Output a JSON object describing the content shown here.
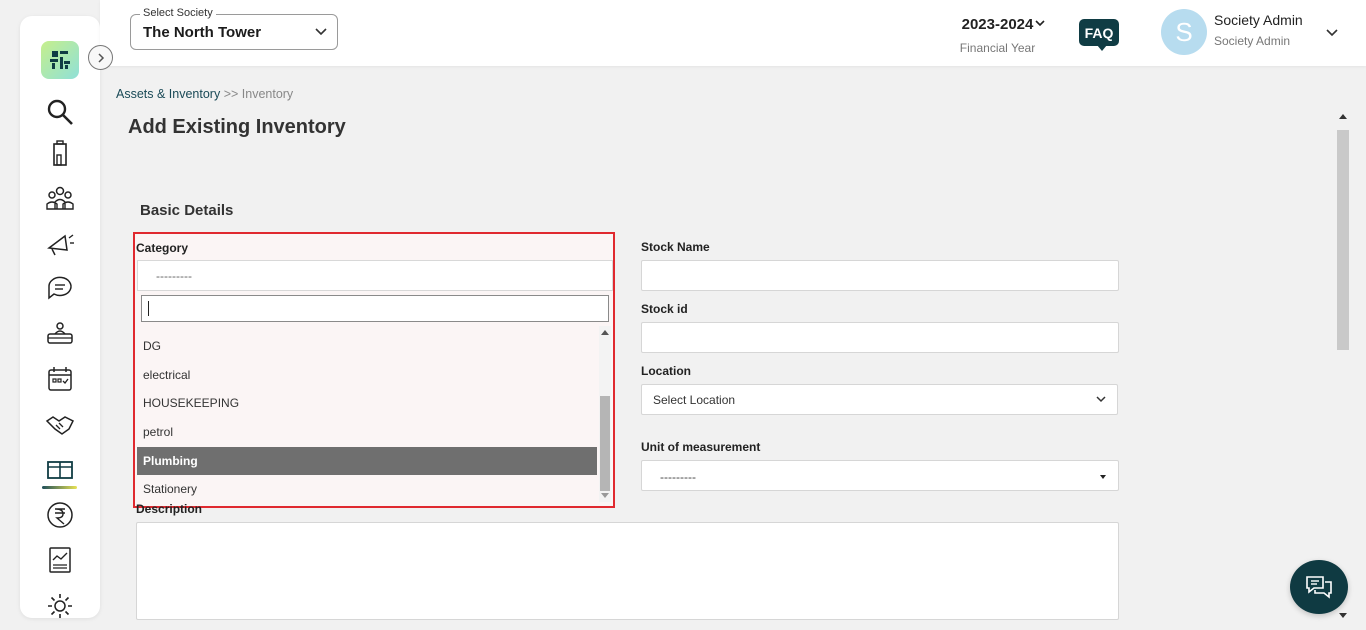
{
  "header": {
    "society_label": "Select Society",
    "society_value": "The North Tower",
    "year": "2023-2024",
    "year_sub": "Financial Year",
    "faq": "FAQ",
    "avatar_letter": "S",
    "user_name": "Society Admin",
    "user_role": "Society Admin"
  },
  "breadcrumb": {
    "parent": "Assets & Inventory",
    "separator": " >> ",
    "current": "Inventory"
  },
  "page": {
    "title": "Add Existing Inventory",
    "section": "Basic Details"
  },
  "form": {
    "category_label": "Category",
    "category_value": "---------",
    "category_search_value": "",
    "category_options": [
      "DG",
      "electrical",
      "HOUSEKEEPING",
      "petrol",
      "Plumbing",
      "Stationery"
    ],
    "category_highlighted": "Plumbing",
    "stock_name_label": "Stock Name",
    "stock_name_value": "",
    "stock_id_label": "Stock id",
    "stock_id_value": "",
    "location_label": "Location",
    "location_value": "Select Location",
    "unit_label": "Unit of measurement",
    "unit_value": "---------",
    "description_label": "Description",
    "description_value": ""
  },
  "sidebar": {
    "icons": [
      "search-icon",
      "building-icon",
      "members-icon",
      "announcement-icon",
      "chat-icon",
      "helpdesk-icon",
      "calendar-icon",
      "handshake-icon",
      "inventory-icon",
      "rupee-icon",
      "report-icon",
      "settings-icon"
    ],
    "active": "inventory-icon"
  },
  "colors": {
    "brand_dark": "#103c44",
    "highlight_border": "#e0292f",
    "selected_option": "#6f6f6f"
  }
}
